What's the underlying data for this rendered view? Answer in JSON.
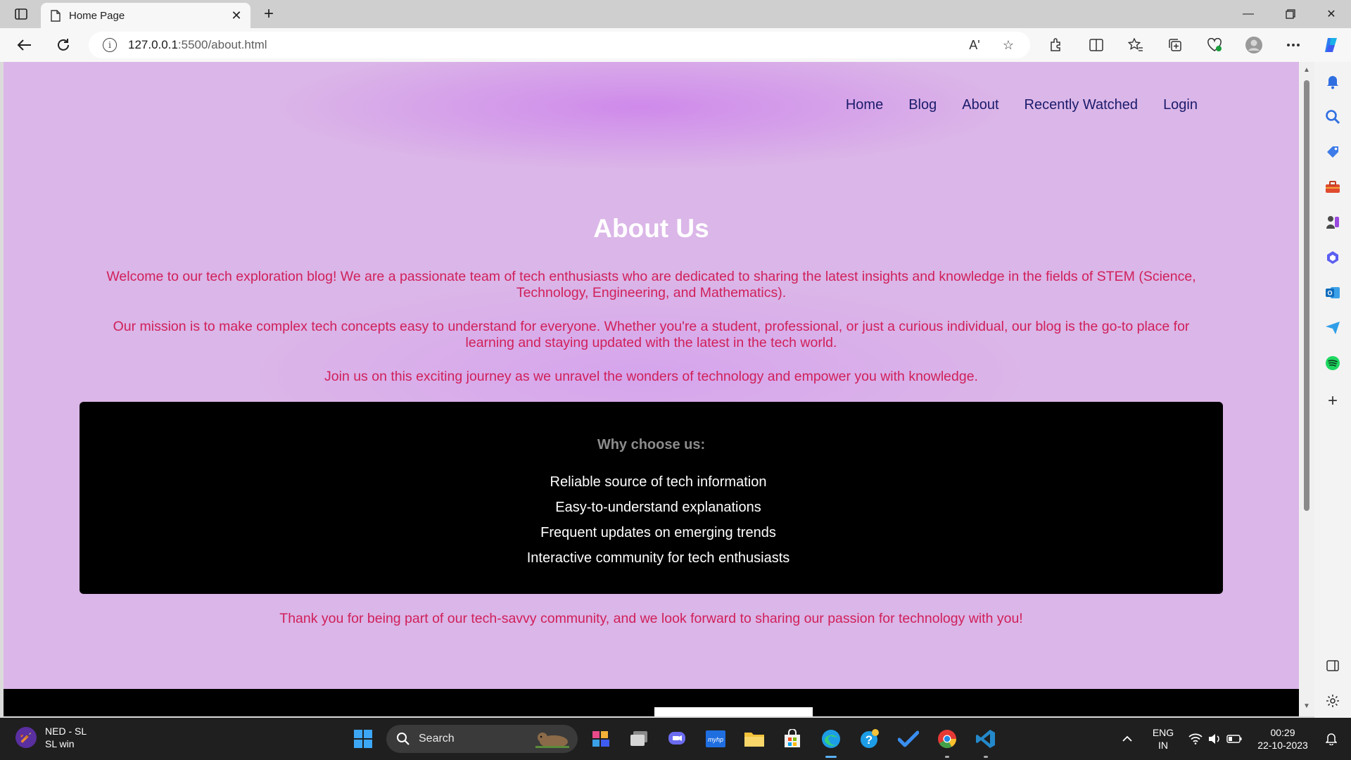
{
  "browser": {
    "tab_title": "Home Page",
    "url_host": "127.0.0.1",
    "url_rest": ":5500/about.html",
    "read_aloud_label": "Aʹ"
  },
  "site": {
    "nav": [
      "Home",
      "Blog",
      "About",
      "Recently Watched",
      "Login"
    ],
    "title": "About Us",
    "paragraphs": [
      "Welcome to our tech exploration blog! We are a passionate team of tech enthusiasts who are dedicated to sharing the latest insights and knowledge in the fields of STEM (Science, Technology, Engineering, and Mathematics).",
      "Our mission is to make complex tech concepts easy to understand for everyone. Whether you're a student, professional, or just a curious individual, our blog is the go-to place for learning and staying updated with the latest in the tech world.",
      "Join us on this exciting journey as we unravel the wonders of technology and empower you with knowledge."
    ],
    "why_title": "Why choose us:",
    "why_items": [
      "Reliable source of tech information",
      "Easy-to-understand explanations",
      "Frequent updates on emerging trends",
      "Interactive community for tech enthusiasts"
    ],
    "closing": "Thank you for being part of our tech-savvy community, and we look forward to sharing our passion for technology with you!"
  },
  "taskbar": {
    "weather_line1": "NED - SL",
    "weather_line2": "SL win",
    "search_label": "Search",
    "lang_line1": "ENG",
    "lang_line2": "IN",
    "time": "00:29",
    "date": "22-10-2023"
  },
  "colors": {
    "page_bg": "#dbb6e8",
    "title": "#ffffff",
    "paragraph": "#d0205a",
    "nav_link": "#1b1b6b",
    "why_box": "#000000"
  }
}
